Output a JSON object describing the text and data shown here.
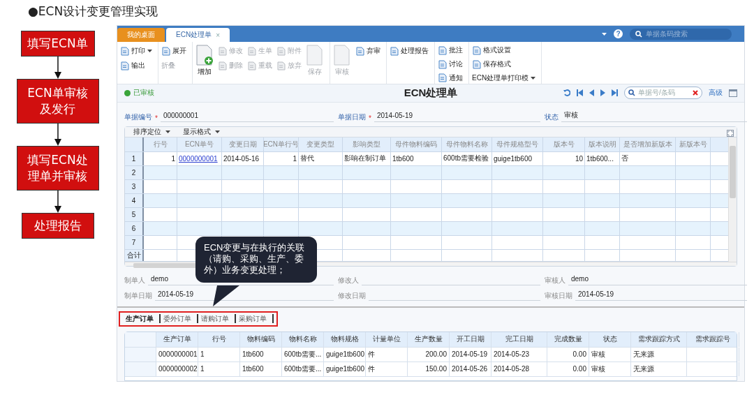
{
  "slide_title": "●ECN设计变更管理实现",
  "flow_steps": [
    "填写ECN单",
    "ECN单审核及发行",
    "填写ECN处理单并审核",
    "处理报告"
  ],
  "window": {
    "tabs": [
      {
        "label": "我的桌面",
        "selected": false
      },
      {
        "label": "ECN处理单",
        "selected": true,
        "close": "×"
      }
    ],
    "help": "?",
    "search": {
      "placeholder": "单据条码搜索"
    }
  },
  "toolbar": [
    {
      "columns": [
        [
          {
            "label": "打印",
            "kind": "dropdown",
            "disabled": false
          },
          {
            "label": "输出",
            "kind": "small",
            "disabled": false
          }
        ]
      ]
    },
    {
      "columns": [
        [
          {
            "label": "展开",
            "kind": "small",
            "disabled": false
          },
          {
            "label": "折叠",
            "kind": "text",
            "disabled": true
          }
        ]
      ]
    },
    {
      "columns": [
        [
          {
            "label": "增加",
            "kind": "large",
            "disabled": false
          }
        ],
        [
          {
            "label": "修改",
            "kind": "small",
            "disabled": true
          },
          {
            "label": "删除",
            "kind": "small",
            "disabled": true
          }
        ],
        [
          {
            "label": "生单",
            "kind": "small",
            "disabled": true
          },
          {
            "label": "重载",
            "kind": "small",
            "disabled": true
          }
        ],
        [
          {
            "label": "附件",
            "kind": "small",
            "disabled": true
          },
          {
            "label": "放弃",
            "kind": "small",
            "disabled": true
          }
        ],
        [
          {
            "label": "保存",
            "kind": "large",
            "disabled": true
          }
        ]
      ]
    },
    {
      "columns": [
        [
          {
            "label": "审核",
            "kind": "large",
            "disabled": true
          }
        ],
        [
          {
            "label": "弃审",
            "kind": "small",
            "disabled": false
          }
        ]
      ]
    },
    {
      "columns": [
        [
          {
            "label": "处理报告",
            "kind": "small",
            "disabled": false
          }
        ]
      ]
    },
    {
      "columns": [
        [
          {
            "label": "批注",
            "kind": "small",
            "disabled": false
          },
          {
            "label": "讨论",
            "kind": "small",
            "disabled": false
          },
          {
            "label": "通知",
            "kind": "small",
            "disabled": false
          }
        ]
      ]
    },
    {
      "columns": [
        [
          {
            "label": "格式设置",
            "kind": "small",
            "disabled": false
          },
          {
            "label": "保存格式",
            "kind": "small",
            "disabled": false
          },
          {
            "label": "ECN处理单打印模",
            "kind": "dropdown-text",
            "disabled": false
          }
        ]
      ]
    }
  ],
  "header": {
    "status": "已审核",
    "title": "ECN处理单",
    "search": {
      "placeholder": "单据号/条码"
    },
    "advanced": "高级"
  },
  "fields": [
    {
      "label": "单据编号",
      "required_mark": "*",
      "value": "000000001"
    },
    {
      "label": "单据日期",
      "required_mark": "*",
      "value": "2014-05-19"
    },
    {
      "label": "状态",
      "value": "审核"
    }
  ],
  "grid": {
    "toolbar": [
      "排序定位",
      "显示格式"
    ],
    "columns": [
      {
        "label": "行号",
        "kind": "number"
      },
      {
        "label": "ECN单号",
        "kind": "link"
      },
      {
        "label": "变更日期",
        "kind": "text"
      },
      {
        "label": "ECN单行号",
        "kind": "number"
      },
      {
        "label": "变更类型",
        "kind": "text"
      },
      {
        "label": "影响类型",
        "kind": "text"
      },
      {
        "label": "母件物料编码",
        "kind": "text"
      },
      {
        "label": "母件物料名称",
        "kind": "text"
      },
      {
        "label": "母件规格型号",
        "kind": "text"
      },
      {
        "label": "版本号",
        "kind": "number"
      },
      {
        "label": "版本说明",
        "kind": "text"
      },
      {
        "label": "是否增加新版本",
        "kind": "text"
      },
      {
        "label": "新版本号",
        "kind": "text"
      }
    ],
    "rows": [
      {
        "num": "1",
        "cells": [
          "1",
          "0000000001",
          "2014-05-16",
          "1",
          "替代",
          "影响在制订单",
          "1tb600",
          "600tb需要检验",
          "guige1tb600",
          "10",
          "1tb600...",
          "否",
          ""
        ]
      },
      {
        "num": "2",
        "cells": []
      },
      {
        "num": "3",
        "cells": []
      },
      {
        "num": "4",
        "cells": []
      },
      {
        "num": "5",
        "cells": []
      },
      {
        "num": "6",
        "cells": []
      },
      {
        "num": "7",
        "cells": []
      }
    ],
    "total_label": "合计"
  },
  "footer_fields": [
    {
      "label": "制单人",
      "value": "demo"
    },
    {
      "label": "修改人"
    },
    {
      "label": "审核人",
      "value": "demo"
    },
    {
      "label": "制单日期",
      "value": "2014-05-19"
    },
    {
      "label": "修改日期"
    },
    {
      "label": "审核日期",
      "value": "2014-05-19"
    }
  ],
  "sub_tabs": [
    {
      "label": "生产订单",
      "selected": true
    },
    {
      "label": "委外订单",
      "selected": false
    },
    {
      "label": "请购订单",
      "selected": false
    },
    {
      "label": "采购订单",
      "selected": false
    }
  ],
  "orders": {
    "columns": [
      {
        "label": "生产订单",
        "kind": "text"
      },
      {
        "label": "行号",
        "kind": "text"
      },
      {
        "label": "物料编码",
        "kind": "text"
      },
      {
        "label": "物料名称",
        "kind": "text"
      },
      {
        "label": "物料规格",
        "kind": "text"
      },
      {
        "label": "计量单位",
        "kind": "text"
      },
      {
        "label": "生产数量",
        "kind": "number"
      },
      {
        "label": "开工日期",
        "kind": "text"
      },
      {
        "label": "完工日期",
        "kind": "text"
      },
      {
        "label": "完成数量",
        "kind": "number"
      },
      {
        "label": "状态",
        "kind": "text"
      },
      {
        "label": "需求跟踪方式",
        "kind": "text"
      },
      {
        "label": "需求跟踪号",
        "kind": "text"
      }
    ],
    "rows": [
      [
        "0000000001",
        "1",
        "1tb600",
        "600tb需要...",
        "guige1tb600",
        "件",
        "200.00",
        "2014-05-19",
        "2014-05-23",
        "0.00",
        "审核",
        "无来源",
        ""
      ],
      [
        "0000000002",
        "1",
        "1tb600",
        "600tb需要...",
        "guige1tb600",
        "件",
        "150.00",
        "2014-05-26",
        "2014-05-28",
        "0.00",
        "审核",
        "无来源",
        ""
      ]
    ]
  },
  "callout": "ECN变更与在执行的关联（请购、采购、生产、委外）业务变更处理；"
}
